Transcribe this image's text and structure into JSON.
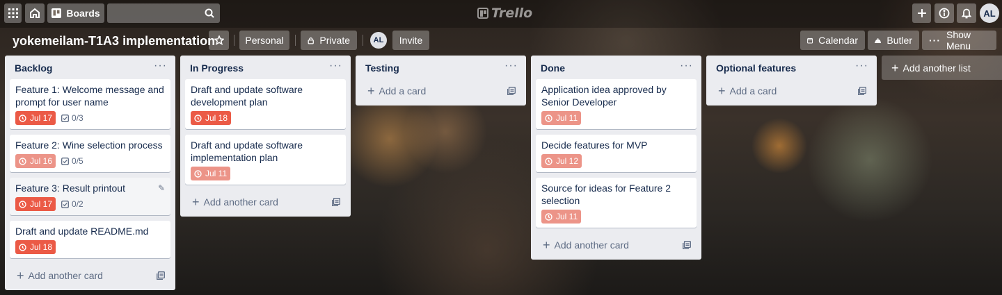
{
  "header": {
    "boards_label": "Boards",
    "logo_text": "Trello",
    "avatar_initials": "AL",
    "icons": [
      "apps-grid-icon",
      "home-icon",
      "boards-icon",
      "search-icon",
      "plus-icon",
      "info-icon",
      "bell-icon"
    ]
  },
  "board": {
    "title": "yokemeilam-T1A3 implementation",
    "visibility_team": "Personal",
    "visibility": "Private",
    "member_initials": "AL",
    "invite_label": "Invite",
    "calendar_label": "Calendar",
    "butler_label": "Butler",
    "show_menu_label": "Show Menu",
    "add_list_label": "Add another list"
  },
  "colors": {
    "overdue": "#eb5a46",
    "due_past": "#ec9488",
    "list_bg": "#ebecf0"
  },
  "lists": [
    {
      "title": "Backlog",
      "cards": [
        {
          "title": "Feature 1: Welcome message and prompt for user name",
          "due": "Jul 17",
          "checklist": "0/3"
        },
        {
          "title": "Feature 2: Wine selection process",
          "due": "Jul 16",
          "checklist": "0/5"
        },
        {
          "title": "Feature 3: Result printout",
          "due": "Jul 17",
          "checklist": "0/2"
        },
        {
          "title": "Draft and update README.md",
          "due": "Jul 18"
        }
      ],
      "add_card_label": "Add another card"
    },
    {
      "title": "In Progress",
      "cards": [
        {
          "title": "Draft and update software development plan",
          "due": "Jul 18"
        },
        {
          "title": "Draft and update software implementation plan",
          "due": "Jul 11"
        }
      ],
      "add_card_label": "Add another card"
    },
    {
      "title": "Testing",
      "cards": [],
      "add_card_label": "Add a card"
    },
    {
      "title": "Done",
      "cards": [
        {
          "title": "Application idea approved by Senior Developer",
          "due": "Jul 11"
        },
        {
          "title": "Decide features for MVP",
          "due": "Jul 12"
        },
        {
          "title": "Source for ideas for Feature 2 selection",
          "due": "Jul 11"
        }
      ],
      "add_card_label": "Add another card"
    },
    {
      "title": "Optional features",
      "cards": [],
      "add_card_label": "Add a card"
    }
  ]
}
